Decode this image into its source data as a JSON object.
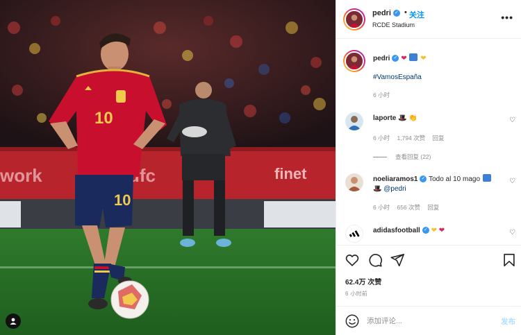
{
  "post": {
    "username": "pedri",
    "follow_label": "关注",
    "dot": "•",
    "location": "RCDE Stadium",
    "more_label": "•••"
  },
  "caption": {
    "username": "pedri",
    "hashtag": "#VamosEspaña",
    "time": "6 小时"
  },
  "comments": [
    {
      "username": "laporte",
      "time": "6 小时",
      "likes": "1,794 次赞",
      "reply_label": "回复",
      "view_replies": "查看回复 (22)"
    },
    {
      "username": "noeliaramos1",
      "text": "Todo al 10 mago",
      "mention": "@pedri",
      "time": "6 小时",
      "likes": "656 次赞",
      "reply_label": "回复"
    },
    {
      "username": "adidasfootball"
    }
  ],
  "footer": {
    "likes": "62.4万 次赞",
    "time": "6 小时前",
    "comment_placeholder": "添加评论...",
    "post_label": "发布"
  },
  "colors": {
    "accent": "#0095f6",
    "spain_red": "#c8102e",
    "spain_navy": "#1b2a5c"
  },
  "icons": {
    "like": "heart-icon",
    "comment": "comment-icon",
    "share": "paper-plane-icon",
    "save": "bookmark-icon",
    "emoji": "smiley-icon",
    "more": "more-options-icon",
    "verified": "verified-badge-icon"
  }
}
